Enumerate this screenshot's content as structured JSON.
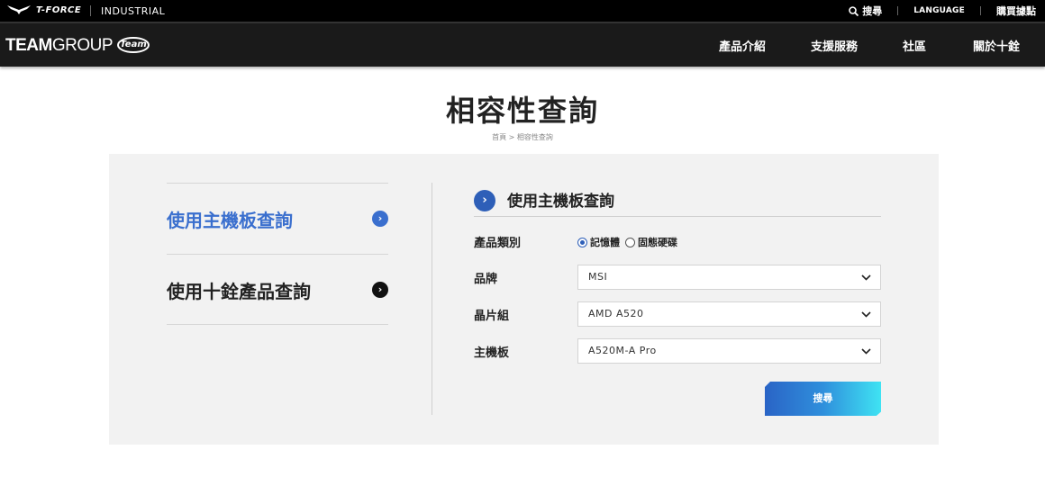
{
  "topbar": {
    "tforce": "T-FORCE",
    "industrial": "INDUSTRIAL",
    "search": "搜尋",
    "language": "LANGUAGE",
    "where_to_buy": "購買據點"
  },
  "header": {
    "logo_bold": "TEAM",
    "logo_thin": "GROUP",
    "logo_badge": "Team",
    "nav": [
      "產品介紹",
      "支援服務",
      "社區",
      "關於十銓"
    ]
  },
  "page": {
    "title": "相容性查詢",
    "breadcrumb": [
      "首頁",
      ">",
      "相容性查詢"
    ]
  },
  "left_menu": [
    {
      "label": "使用主機板查詢",
      "active": true
    },
    {
      "label": "使用十銓產品查詢",
      "active": false
    }
  ],
  "form": {
    "title": "使用主機板查詢",
    "category_label": "產品類別",
    "category_options": [
      "記憶體",
      "固態硬碟"
    ],
    "category_selected": "記憶體",
    "brand_label": "品牌",
    "brand_value": "MSI",
    "chipset_label": "晶片組",
    "chipset_value": "AMD A520",
    "motherboard_label": "主機板",
    "motherboard_value": "A520M-A Pro",
    "search_button": "搜尋"
  },
  "colors": {
    "accent": "#3a6fce",
    "header_bg": "#1a1a1a",
    "panel_bg": "#f2f2f2"
  }
}
